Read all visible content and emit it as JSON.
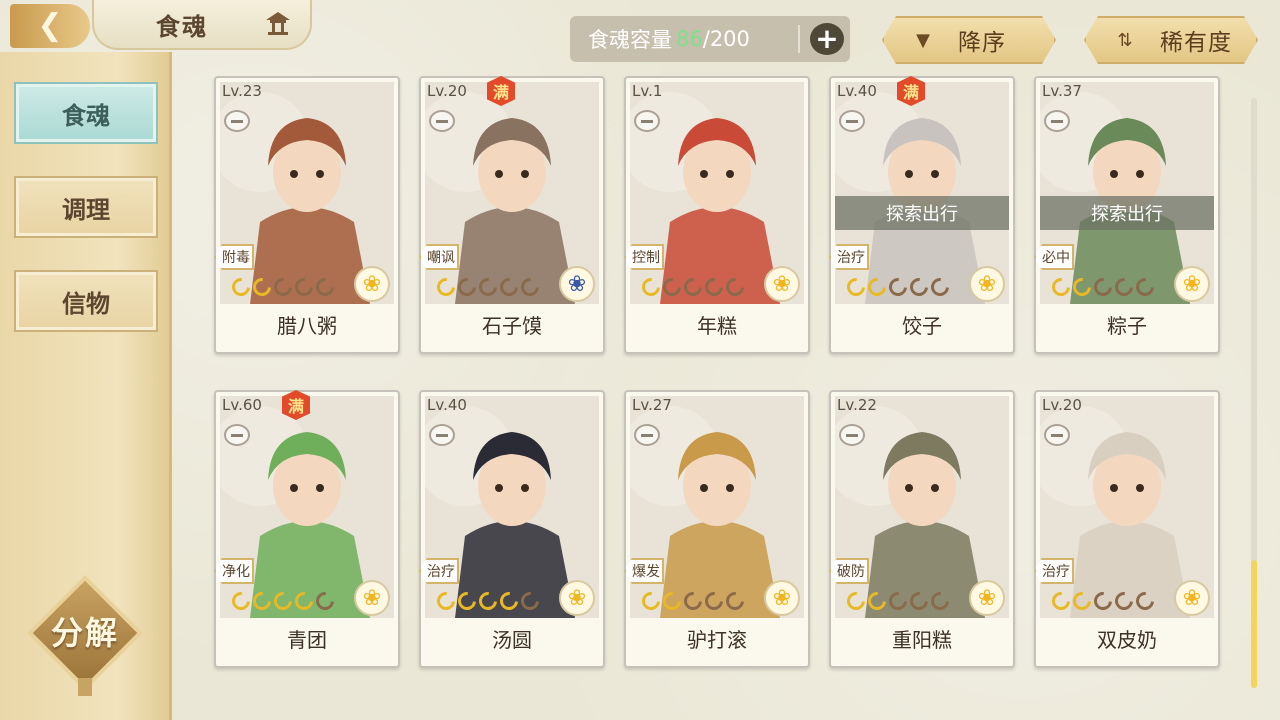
{
  "header": {
    "title": "食魂",
    "capacity_label": "食魂容量",
    "capacity_current": "86",
    "capacity_sep": "/",
    "capacity_max": "200",
    "add_label": "+",
    "sort_order_label": "降序",
    "sort_field_label": "稀有度"
  },
  "sidebar": {
    "tabs": [
      {
        "label": "食魂",
        "active": true
      },
      {
        "label": "调理",
        "active": false
      },
      {
        "label": "信物",
        "active": false
      }
    ],
    "decompose_label": "分解"
  },
  "colors": {
    "accent_gold": "#e3c684",
    "active_tab": "#a9d9d4",
    "capacity_green": "#7fe08a",
    "full_badge": "#e24a2a"
  },
  "cards": [
    {
      "level": "Lv.23",
      "full": false,
      "tag": "附毒",
      "name": "腊八粥",
      "skills_on": 2,
      "status": "",
      "flower": "gold",
      "hue": "#a35a3a"
    },
    {
      "level": "Lv.20",
      "full": true,
      "full_label": "满",
      "tag": "嘲讽",
      "name": "石子馍",
      "skills_on": 1,
      "status": "",
      "flower": "blue",
      "hue": "#8a7260"
    },
    {
      "level": "Lv.1",
      "full": false,
      "tag": "控制",
      "name": "年糕",
      "skills_on": 1,
      "status": "",
      "flower": "gold",
      "hue": "#c94a36"
    },
    {
      "level": "Lv.40",
      "full": true,
      "full_label": "满",
      "tag": "治疗",
      "name": "饺子",
      "skills_on": 2,
      "status": "探索出行",
      "flower": "gold",
      "hue": "#c9c3c0"
    },
    {
      "level": "Lv.37",
      "full": false,
      "tag": "必中",
      "name": "粽子",
      "skills_on": 2,
      "status": "探索出行",
      "flower": "gold",
      "hue": "#6b8a5a"
    },
    {
      "level": "Lv.60",
      "full": true,
      "full_label": "满",
      "tag": "净化",
      "name": "青团",
      "skills_on": 4,
      "status": "",
      "flower": "gold",
      "hue": "#6fae5a"
    },
    {
      "level": "Lv.40",
      "full": false,
      "tag": "治疗",
      "name": "汤圆",
      "skills_on": 4,
      "status": "",
      "flower": "gold",
      "hue": "#2b2b35"
    },
    {
      "level": "Lv.27",
      "full": false,
      "tag": "爆发",
      "name": "驴打滚",
      "skills_on": 2,
      "status": "",
      "flower": "gold",
      "hue": "#c99a4a"
    },
    {
      "level": "Lv.22",
      "full": false,
      "tag": "破防",
      "name": "重阳糕",
      "skills_on": 2,
      "status": "",
      "flower": "gold",
      "hue": "#7d7a60"
    },
    {
      "level": "Lv.20",
      "full": false,
      "tag": "治疗",
      "name": "双皮奶",
      "skills_on": 2,
      "status": "",
      "flower": "gold",
      "hue": "#d9cfc0"
    }
  ]
}
